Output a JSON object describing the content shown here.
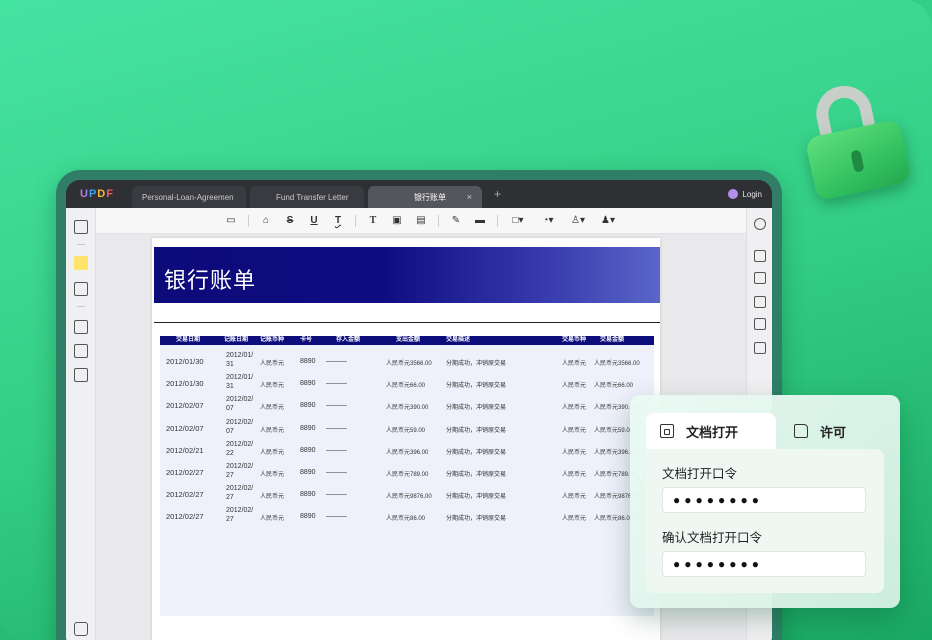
{
  "app": {
    "logo_letters": [
      "U",
      "P",
      "D",
      "F"
    ],
    "tabs": [
      {
        "label": "Personal-Loan-Agreemen",
        "active": false
      },
      {
        "label": "Fund Transfer Letter",
        "active": false
      },
      {
        "label": "银行账单",
        "active": true
      }
    ],
    "new_tab": "+",
    "close_tab": "×",
    "login": "Login"
  },
  "toolbar": {
    "tools": [
      "comment",
      "highlight",
      "strikethrough",
      "underline",
      "squiggly",
      "text",
      "textbox",
      "text-callout",
      "pencil",
      "eraser",
      "shape",
      "sticker",
      "stamp",
      "signature"
    ],
    "glyphs": {
      "strikethrough": "S",
      "underline": "U",
      "squiggly": "T",
      "text": "T"
    }
  },
  "document": {
    "banner_title": "银行账单",
    "table": {
      "headers": [
        "交易日期",
        "记账日期",
        "记账币种",
        "卡号",
        "存入金额",
        "支出金额",
        "交易描述",
        "交易币种",
        "交易金额"
      ],
      "rows": [
        {
          "date": "2012/01/30",
          "post": "2012/01/31",
          "cur": "人民币元",
          "card": "8890",
          "dep": "———",
          "out": "人民币元3566.00",
          "desc": "分期成功，冲销原交易",
          "tcur": "人民币元",
          "amt": "人民币元3566.00"
        },
        {
          "date": "2012/01/30",
          "post": "2012/01/31",
          "cur": "人民币元",
          "card": "8890",
          "dep": "———",
          "out": "人民币元66.00",
          "desc": "分期成功，冲销原交易",
          "tcur": "人民币元",
          "amt": "人民币元66.00"
        },
        {
          "date": "2012/02/07",
          "post": "2012/02/07",
          "cur": "人民币元",
          "card": "8890",
          "dep": "———",
          "out": "人民币元390.00",
          "desc": "分期成功，冲销原交易",
          "tcur": "人民币元",
          "amt": "人民币元390.00"
        },
        {
          "date": "2012/02/07",
          "post": "2012/02/07",
          "cur": "人民币元",
          "card": "8890",
          "dep": "———",
          "out": "人民币元59.00",
          "desc": "分期成功，冲销原交易",
          "tcur": "人民币元",
          "amt": "人民币元59.00"
        },
        {
          "date": "2012/02/21",
          "post": "2012/02/22",
          "cur": "人民币元",
          "card": "8890",
          "dep": "———",
          "out": "人民币元396.00",
          "desc": "分期成功，冲销原交易",
          "tcur": "人民币元",
          "amt": "人民币元396.00"
        },
        {
          "date": "2012/02/27",
          "post": "2012/02/27",
          "cur": "人民币元",
          "card": "8890",
          "dep": "———",
          "out": "人民币元789.00",
          "desc": "分期成功，冲销原交易",
          "tcur": "人民币元",
          "amt": "人民币元789.00"
        },
        {
          "date": "2012/02/27",
          "post": "2012/02/27",
          "cur": "人民币元",
          "card": "8890",
          "dep": "———",
          "out": "人民币元9876.00",
          "desc": "分期成功，冲销原交易",
          "tcur": "人民币元",
          "amt": "人民币元9876.00"
        },
        {
          "date": "2012/02/27",
          "post": "2012/02/27",
          "cur": "人民币元",
          "card": "8890",
          "dep": "———",
          "out": "人民币元86.00",
          "desc": "分期成功，冲销原交易",
          "tcur": "人民币元",
          "amt": "人民币元86.00"
        }
      ]
    }
  },
  "security_panel": {
    "tabs": [
      {
        "label": "文档打开",
        "icon": "document-lock-icon",
        "active": true
      },
      {
        "label": "许可",
        "icon": "edit-permission-icon",
        "active": false
      }
    ],
    "open_password_label": "文档打开口令",
    "open_password_value": "●●●●●●●●",
    "confirm_password_label": "确认文档打开口令",
    "confirm_password_value": "●●●●●●●●"
  },
  "colors": {
    "background": "#34cf85",
    "frame": "#2f7e65",
    "banner": "#0d0a7a",
    "table_header": "#0c0c7a",
    "lock_body": "#2ebd5c"
  }
}
